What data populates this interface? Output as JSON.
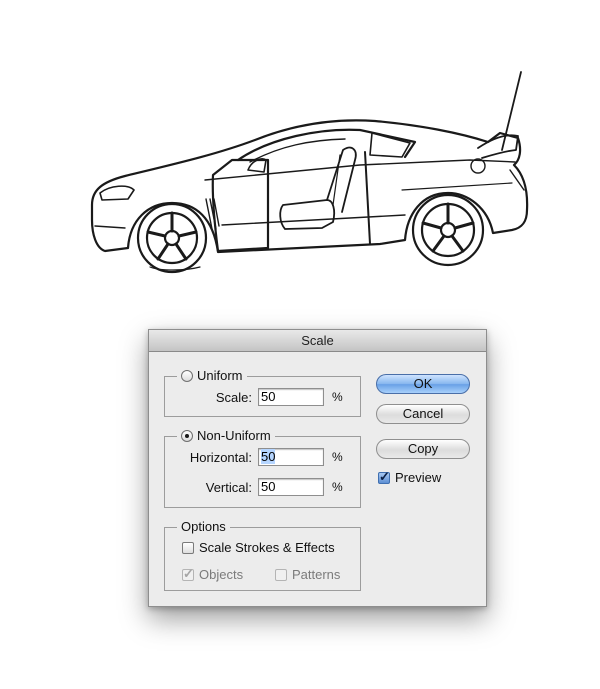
{
  "dialog": {
    "title": "Scale",
    "uniform": {
      "label": "Uniform",
      "selected": false,
      "scale_label": "Scale:",
      "scale_value": "50",
      "unit": "%"
    },
    "non_uniform": {
      "label": "Non-Uniform",
      "selected": true,
      "horizontal_label": "Horizontal:",
      "horizontal_value": "50",
      "vertical_label": "Vertical:",
      "vertical_value": "50",
      "unit": "%"
    },
    "options": {
      "label": "Options",
      "scale_strokes_label": "Scale Strokes & Effects",
      "scale_strokes_checked": false,
      "objects_label": "Objects",
      "objects_checked": true,
      "patterns_label": "Patterns",
      "patterns_checked": false
    },
    "buttons": {
      "ok": "OK",
      "cancel": "Cancel",
      "copy": "Copy"
    },
    "preview": {
      "label": "Preview",
      "checked": true
    }
  },
  "colors": {
    "default_button": "#7fb0ec",
    "selection": "#b5d5ff",
    "dialog_bg": "#ececec"
  },
  "icons": {
    "artwork": "car-line-art"
  }
}
